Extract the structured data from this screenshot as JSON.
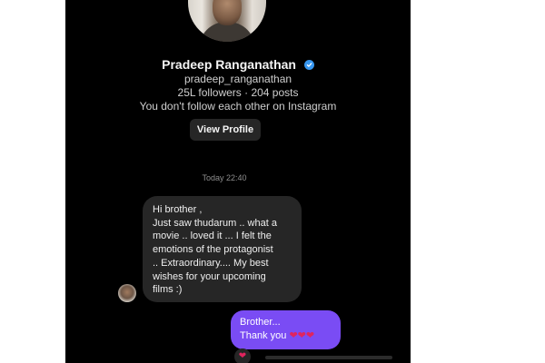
{
  "profile": {
    "name": "Pradeep Ranganathan",
    "handle": "pradeep_ranganathan",
    "stats": "25L followers · 204 posts",
    "follow_note": "You don't follow each other on Instagram",
    "view_profile_label": "View Profile"
  },
  "thread": {
    "timestamp": "Today 22:40",
    "incoming": {
      "lines": [
        "Hi brother ,",
        "Just saw thudarum .. what a",
        "movie .. loved it ... I felt the",
        "emotions of the protagonist",
        ".. Extraordinary.... My best",
        "wishes for your upcoming",
        "films :)"
      ]
    },
    "outgoing": {
      "line1": "Brother...",
      "line2": "Thank you",
      "emoji": "❤❤❤"
    },
    "reaction": "❤"
  },
  "colors": {
    "background": "#000000",
    "incoming_bubble": "#262626",
    "outgoing_bubble": "#7a4cf4",
    "verified": "#3797f0",
    "heart": "#e0245e"
  },
  "icons": [
    "verified-badge-icon",
    "heart-icon"
  ]
}
